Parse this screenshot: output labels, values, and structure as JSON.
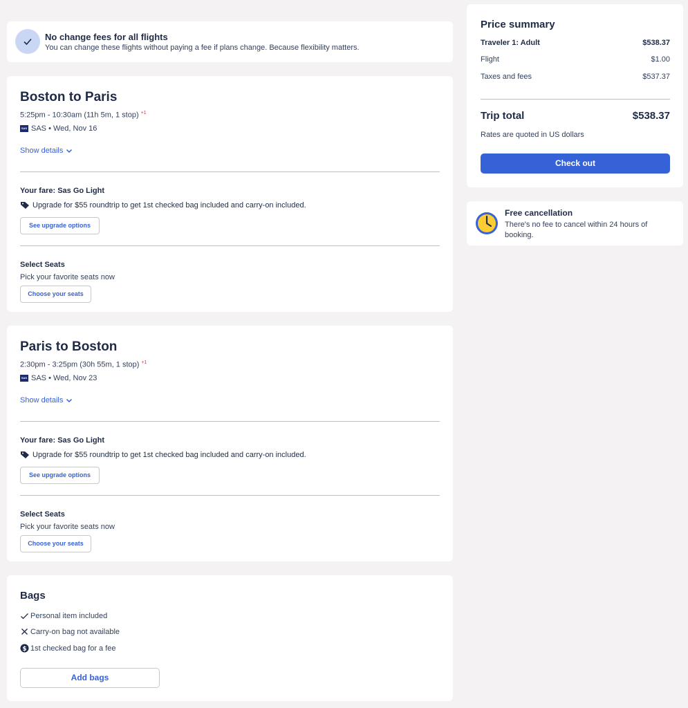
{
  "banner": {
    "title": "No change fees for all flights",
    "subtitle": "You can change these flights without paying a fee if plans change. Because flexibility matters.",
    "icon": "check-icon"
  },
  "outbound": {
    "route": "Boston to Paris",
    "time": "5:25pm - 10:30am (11h 5m, 1 stop)",
    "day_offset": "+1",
    "airline_date": "SAS • Wed, Nov 16",
    "show_details": "Show details",
    "fare_label": "Your fare: Sas Go Light",
    "upgrade_text": "Upgrade for $55 roundtrip to get 1st checked bag included and carry-on included.",
    "upgrade_button": "See upgrade options",
    "seats_label": "Select Seats",
    "seats_sub": "Pick your favorite seats now",
    "seats_button": "Choose your seats"
  },
  "return": {
    "route": "Paris to Boston",
    "time": "2:30pm - 3:25pm (30h 55m, 1 stop)",
    "day_offset": "+1",
    "airline_date": "SAS • Wed, Nov 23",
    "show_details": "Show details",
    "fare_label": "Your fare: Sas Go Light",
    "upgrade_text": "Upgrade for $55 roundtrip to get 1st checked bag included and carry-on included.",
    "upgrade_button": "See upgrade options",
    "seats_label": "Select Seats",
    "seats_sub": "Pick your favorite seats now",
    "seats_button": "Choose your seats"
  },
  "bags": {
    "title": "Bags",
    "items": [
      {
        "label": "Personal item included",
        "icon": "check-icon"
      },
      {
        "label": "Carry-on bag not available",
        "icon": "x-icon"
      },
      {
        "label": "1st checked bag for a fee",
        "icon": "dollar-icon"
      }
    ],
    "add_button": "Add bags"
  },
  "price_summary": {
    "title": "Price summary",
    "traveler_label": "Traveler 1: Adult",
    "traveler_amount": "$538.37",
    "flight_label": "Flight",
    "flight_amount": "$1.00",
    "taxes_label": "Taxes and fees",
    "taxes_amount": "$537.37",
    "total_label": "Trip total",
    "total_amount": "$538.37",
    "rates_note": "Rates are quoted in US dollars",
    "checkout_button": "Check out"
  },
  "cancellation": {
    "title": "Free cancellation",
    "subtitle": "There's no fee to cancel within 24 hours of booking.",
    "icon": "clock-icon"
  },
  "colors": {
    "accent": "#3662d8",
    "text": "#1f2b46",
    "background": "#f4f2f2",
    "day_offset": "#d6343f"
  }
}
